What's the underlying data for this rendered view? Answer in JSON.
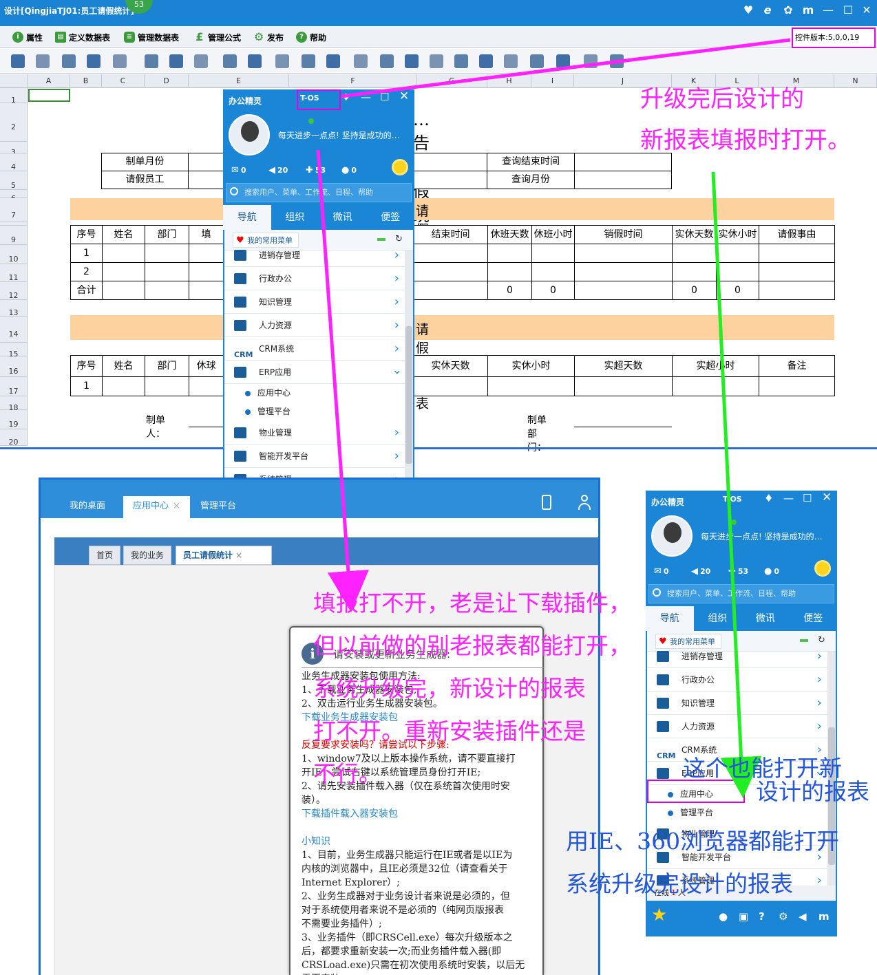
{
  "window": {
    "title": "设计[QingjiaTJ01:员工请假统计]",
    "badge": "53",
    "buttons": [
      "♥",
      "e",
      "✿",
      "m",
      "—",
      "☐",
      "✕"
    ]
  },
  "menu": [
    {
      "label": "属性",
      "icon": "info-icon",
      "color": "#3b9b3b"
    },
    {
      "label": "定义数据表",
      "icon": "table-define-icon",
      "color": "#3b9b3b"
    },
    {
      "label": "管理数据表",
      "icon": "database-icon",
      "color": "#3b9b3b"
    },
    {
      "label": "管理公式",
      "icon": "formula-icon",
      "color": "#3b9b3b"
    },
    {
      "label": "发布",
      "icon": "gear-icon",
      "color": "#3b9b3b"
    },
    {
      "label": "帮助",
      "icon": "help-icon",
      "color": "#3b9b3b"
    }
  ],
  "control_version": "控件版本:5,0,0,19",
  "sheet": {
    "columns": [
      "A",
      "B",
      "C",
      "D",
      "E",
      "F",
      "G",
      "H",
      "I",
      "J",
      "K",
      "L",
      "M",
      "N"
    ],
    "rows": [
      "1",
      "2",
      "3",
      "4",
      "5",
      "6",
      "7",
      "8",
      "9",
      "10",
      "11",
      "12",
      "13",
      "14",
      "15",
      "16",
      "17",
      "18",
      "19",
      "20"
    ],
    "title": "…告请假统计表",
    "labels": {
      "month": "制单月份",
      "employee": "请假员工",
      "end_time": "查询结束时间",
      "query_month": "查询月份"
    },
    "section1": "请假明细表",
    "detail_headers": [
      "序号",
      "姓名",
      "部门",
      "填",
      "结束时间",
      "休班天数",
      "休班小时",
      "销假时间",
      "实休天数",
      "实休小时",
      "请假事由"
    ],
    "detail_rows": [
      [
        "1"
      ],
      [
        "2"
      ],
      [
        "合计",
        "0",
        "0",
        "0",
        "0"
      ]
    ],
    "section2": "请假汇总表",
    "summary_headers": [
      "序号",
      "姓名",
      "部门",
      "休球",
      "实休天数",
      "实休小时",
      "实超天数",
      "实超小时",
      "备注"
    ],
    "summary_rows": [
      [
        "1"
      ]
    ],
    "footer": {
      "maker": "制单人：",
      "dept": "制单部门："
    }
  },
  "sprite1": {
    "title": "办公精灵",
    "tos": "T-OS",
    "motto": "每天进步一点点! 坚持是成功的…",
    "stats": [
      "0",
      "20",
      "53",
      "0"
    ],
    "search": "搜索用户、菜单、工作流、日程、帮助",
    "tabs": [
      "导航",
      "组织",
      "微讯",
      "便签"
    ],
    "fav": "我的常用菜单",
    "items": [
      "进销存管理",
      "行政办公",
      "知识管理",
      "人力资源",
      "CRM系统",
      "ERP应用",
      "物业管理",
      "智能开发平台",
      "系统管理"
    ],
    "subitems": [
      "应用中心",
      "管理平台"
    ]
  },
  "sprite2": {
    "title": "办公精灵",
    "tos": "T-OS",
    "motto": "每天进步一点点! 坚持是成功的…",
    "stats": [
      "0",
      "20",
      "53",
      "0"
    ],
    "search": "搜索用户、菜单、工作流、日程、帮助",
    "tabs": [
      "导航",
      "组织",
      "微讯",
      "便签"
    ],
    "fav": "我的常用菜单",
    "items": [
      "进销存管理",
      "行政办公",
      "知识管理",
      "人力资源",
      "CRM系统",
      "ERP应用",
      "物业管理",
      "智能开发平台",
      "系统管理"
    ],
    "subitems": [
      "应用中心",
      "管理平台"
    ],
    "online": "在线",
    "online_count": "1",
    "online_unit": "人"
  },
  "app": {
    "tabs": [
      "我的桌面",
      "应用中心",
      "管理平台"
    ],
    "subtabs": [
      "首页",
      "我的业务",
      "员工请假统计"
    ]
  },
  "dialog": {
    "title": "请安装或更新业务生成器:",
    "lines": [
      {
        "t": "业务生成器安装包使用方法:",
        "c": ""
      },
      {
        "t": "1、下载业务生成器安装包,",
        "c": ""
      },
      {
        "t": "2、双击运行业务生成器安装包。",
        "c": ""
      },
      {
        "t": "下载业务生成器安装包",
        "c": "blue"
      },
      {
        "t": "",
        "c": ""
      },
      {
        "t": "反复要求安装吗？请尝试以下步骤:",
        "c": "red"
      },
      {
        "t": "1、window7及以上版本操作系统，请不要直接打",
        "c": ""
      },
      {
        "t": "开IE，尝试右键以系统管理员身份打开IE;",
        "c": ""
      },
      {
        "t": "2、请先安装插件载入器（仅在系统首次使用时安",
        "c": ""
      },
      {
        "t": "装）。",
        "c": ""
      },
      {
        "t": "下载插件载入器安装包",
        "c": "blue"
      },
      {
        "t": "",
        "c": ""
      },
      {
        "t": "小知识",
        "c": "blue"
      },
      {
        "t": "1、目前，业务生成器只能运行在IE或者是以IE为",
        "c": ""
      },
      {
        "t": "内核的浏览器中，且IE必须是32位（请查看关于",
        "c": ""
      },
      {
        "t": "Internet Explorer）;",
        "c": ""
      },
      {
        "t": "2、业务生成器对于业务设计者来说是必须的，但",
        "c": ""
      },
      {
        "t": "对于系统使用者来说不是必须的（纯网页版报表",
        "c": ""
      },
      {
        "t": "不需要业务插件）;",
        "c": ""
      },
      {
        "t": "3、业务插件（即CRSCell.exe）每次升级版本之",
        "c": ""
      },
      {
        "t": "后，都要求重新安装一次;而业务插件载入器(即",
        "c": ""
      },
      {
        "t": "CRSLoad.exe)只需在初次使用系统时安装，以后无",
        "c": ""
      },
      {
        "t": "需再安装。",
        "c": ""
      }
    ]
  },
  "annotations": {
    "top_right": [
      "升级完后设计的",
      "新报表填报时打开。"
    ],
    "middle": [
      "填报打不开，老是让下载插件，",
      "但以前做的别老报表都能打开，",
      "系统升级完，新设计的报表",
      "打不开。重新安装插件还是",
      "不行。"
    ],
    "right1": [
      "这个也能打开新",
      "设计的报表"
    ],
    "right2": [
      "用IE、360浏览器都能打开",
      "系统升级完设计的报表"
    ]
  },
  "colors": {
    "accent": "#1b86d6",
    "annotation": "#ff22ff",
    "annotation_blue": "#2356d8",
    "band": "#fdd29e",
    "arrow_green": "#22ee22"
  }
}
